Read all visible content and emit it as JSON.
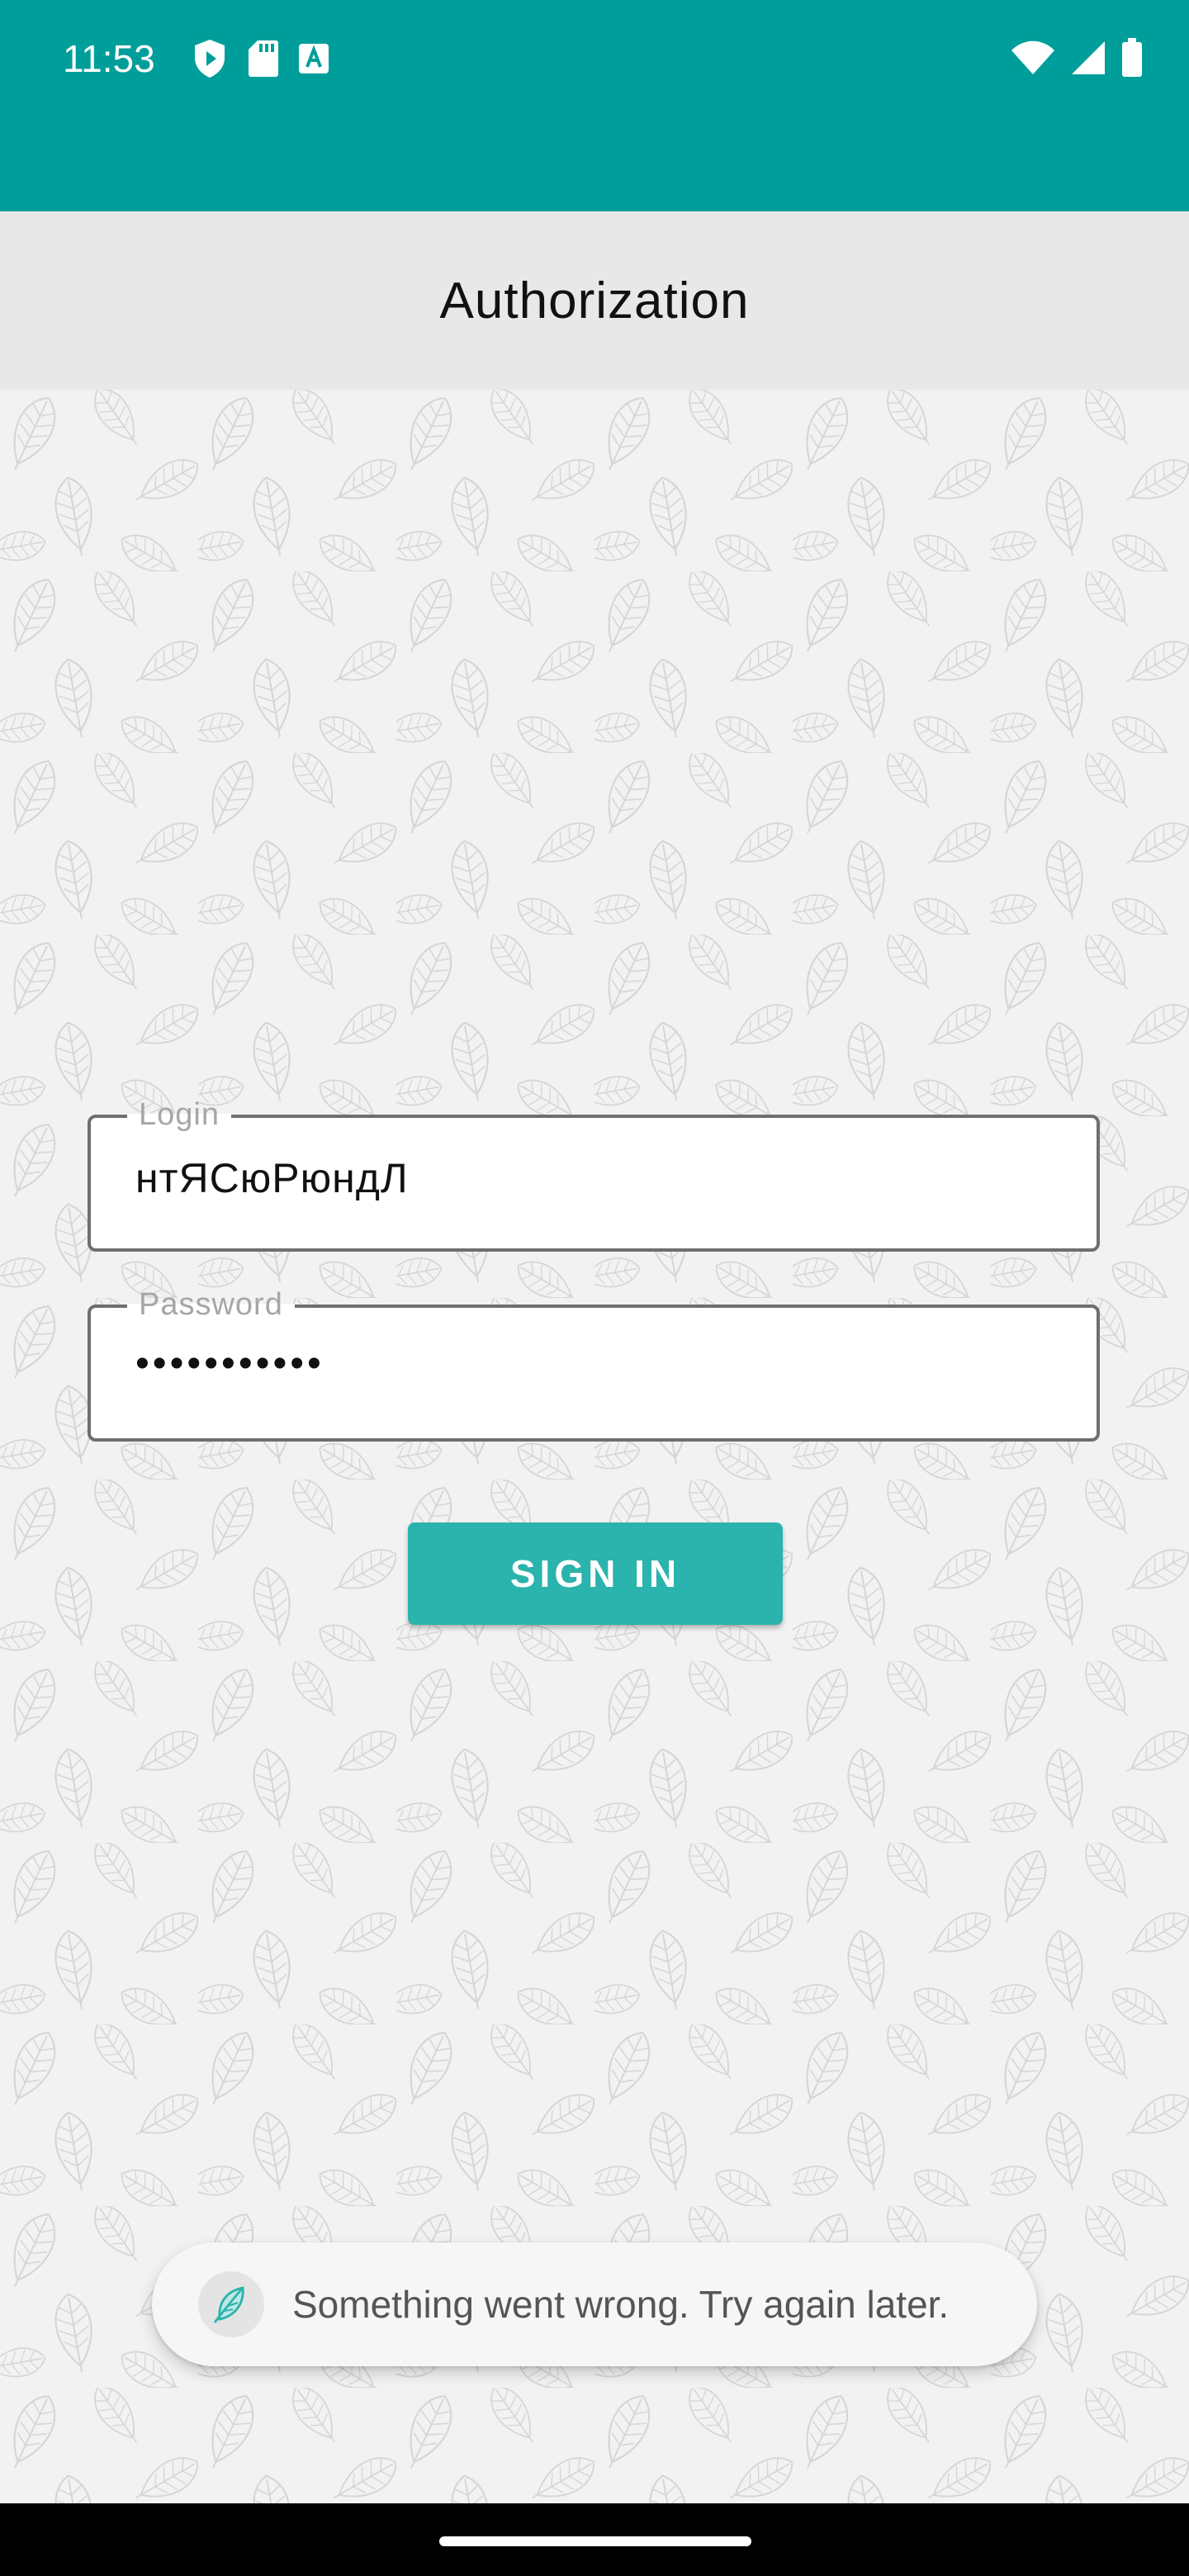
{
  "status_bar": {
    "time": "11:53",
    "icons_left": [
      "shield-play-icon",
      "sd-card-icon",
      "text-a-icon"
    ],
    "icons_right": [
      "wifi-icon",
      "signal-icon",
      "battery-icon"
    ]
  },
  "header": {
    "title": "Authorization"
  },
  "form": {
    "login": {
      "label": "Login",
      "value": "нтЯСюРюндЛ"
    },
    "password": {
      "label": "Password",
      "value": "•••••••••••"
    },
    "sign_in_label": "SIGN IN"
  },
  "toast": {
    "message": "Something went wrong. Try again later.",
    "icon": "app-leaf-icon"
  },
  "colors": {
    "status_bar": "#009e9a",
    "header_bg": "#e8e8e8",
    "button": "#2bb3ad",
    "background": "#f2f2f2"
  }
}
